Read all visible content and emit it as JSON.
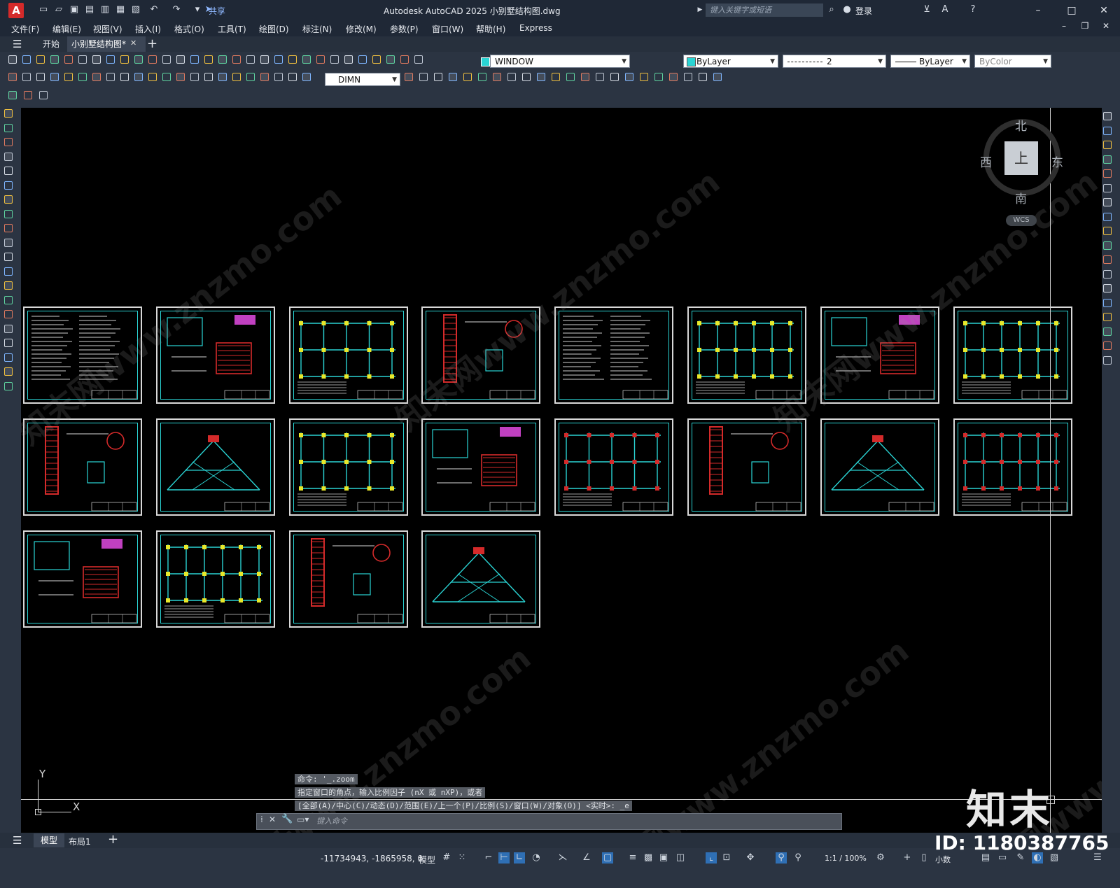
{
  "app": {
    "logo_letter": "A",
    "title": "Autodesk AutoCAD 2025    小别墅结构图.dwg",
    "share_label": "共享",
    "search_placeholder": "键入关键字或短语",
    "login_label": "登录"
  },
  "menu": [
    "文件(F)",
    "编辑(E)",
    "视图(V)",
    "插入(I)",
    "格式(O)",
    "工具(T)",
    "绘图(D)",
    "标注(N)",
    "修改(M)",
    "参数(P)",
    "窗口(W)",
    "帮助(H)",
    "Express"
  ],
  "tabs": {
    "start": "开始",
    "document": "小别墅结构图*"
  },
  "toolbar": {
    "workspace_value": "WINDOW",
    "color_value": "ByLayer",
    "linetype_value": "2",
    "lineweight_value": "ByLayer",
    "plotstyle_value": "ByColor",
    "dimstyle_value": "DIMN"
  },
  "viewcube": {
    "north": "北",
    "south": "南",
    "east": "东",
    "west": "西",
    "face": "上",
    "wcs": "WCS"
  },
  "axes": {
    "y": "Y",
    "x": "X"
  },
  "command": {
    "line1": "命令: '_.zoom",
    "line2": "指定窗口的角点，输入比例因子 (nX 或 nXP)，或者",
    "line3": "[全部(A)/中心(C)/动态(D)/范围(E)/上一个(P)/比例(S)/窗口(W)/对象(O)] <实时>: _e",
    "input_placeholder": "键入命令"
  },
  "layout_tabs": {
    "model": "模型",
    "layout1": "布局1"
  },
  "status": {
    "coords": "-11734943, -1865958, 0",
    "model": "模型",
    "scale": "1:1 / 100%",
    "units": "小数"
  },
  "watermark": {
    "logo": "知末",
    "id": "ID: 1180387765",
    "text": "知末网www.znzmo.com"
  },
  "colors": {
    "canvas": "#000000",
    "cyan": "#2ad4d4",
    "red": "#d42a2a",
    "yellow": "#e8e82a",
    "frame": "#1f2836",
    "brand": "#d42a2a"
  },
  "icons": [
    "new-icon",
    "open-icon",
    "save-icon",
    "plot-icon",
    "undo-icon",
    "redo-icon",
    "search-icon",
    "user-icon",
    "cart-icon",
    "help-icon",
    "minimize-icon",
    "maximize-icon",
    "close-icon",
    "hamburger-icon",
    "plus-icon",
    "grid-icon",
    "snap-icon",
    "ortho-icon",
    "polar-icon",
    "gear-icon"
  ]
}
